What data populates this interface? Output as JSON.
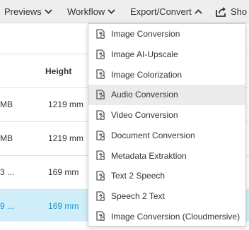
{
  "toolbar": {
    "previews": "Previews",
    "workflow": "Workflow",
    "export_convert": "Export/Convert",
    "show": "Sho"
  },
  "table": {
    "header_height": "Height",
    "rows": [
      {
        "size": "MB",
        "height": "1219 mm",
        "selected": false
      },
      {
        "size": "MB",
        "height": "1219 mm",
        "selected": false
      },
      {
        "size": "3 ...",
        "height": "169 mm",
        "selected": false
      },
      {
        "size": "9 ...",
        "height": "169 mm",
        "selected": true
      }
    ]
  },
  "menu": {
    "items": [
      {
        "label": "Image Conversion"
      },
      {
        "label": "Image AI-Upscale"
      },
      {
        "label": "Image Colorization"
      },
      {
        "label": "Audio Conversion",
        "hover": true
      },
      {
        "label": "Video Conversion"
      },
      {
        "label": "Document Conversion"
      },
      {
        "label": "Metadata Extraktion"
      },
      {
        "label": "Text 2 Speech"
      },
      {
        "label": "Speech 2 Text"
      },
      {
        "label": "Image Conversion (Cloudmersive)"
      }
    ]
  },
  "colors": {
    "toolbar_bg": "#eeeeee",
    "selected_row_bg": "#cfeefa",
    "selected_text": "#1a96c8",
    "menu_hover": "#ebebeb"
  }
}
